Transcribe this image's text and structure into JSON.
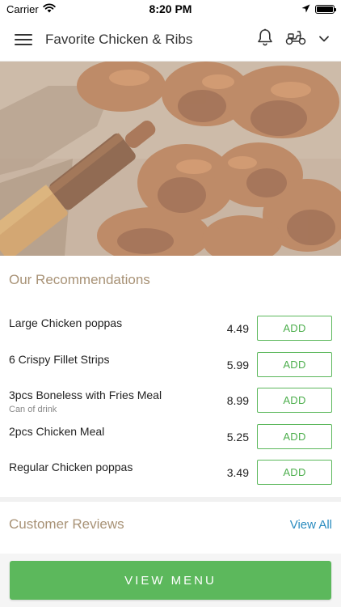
{
  "status_bar": {
    "carrier": "Carrier",
    "time": "8:20 PM"
  },
  "header": {
    "title": "Favorite Chicken & Ribs"
  },
  "icons": {
    "menu": "hamburger-menu-icon",
    "bell": "bell-icon",
    "delivery": "scooter-icon",
    "dropdown": "chevron-down-icon"
  },
  "recommendations": {
    "title": "Our Recommendations",
    "items": [
      {
        "name": "Large Chicken poppas",
        "subtitle": "",
        "price": "4.49",
        "button": "ADD"
      },
      {
        "name": "6 Crispy Fillet Strips",
        "subtitle": "",
        "price": "5.99",
        "button": "ADD"
      },
      {
        "name": "3pcs Boneless with Fries Meal",
        "subtitle": "Can of drink",
        "price": "8.99",
        "button": "ADD"
      },
      {
        "name": "2pcs Chicken Meal",
        "subtitle": "",
        "price": "5.25",
        "button": "ADD"
      },
      {
        "name": "Regular Chicken poppas",
        "subtitle": "",
        "price": "3.49",
        "button": "ADD"
      }
    ]
  },
  "reviews": {
    "title": "Customer Reviews",
    "view_all": "View All"
  },
  "footer": {
    "view_menu": "VIEW MENU"
  },
  "colors": {
    "accent_green": "#5cb85c",
    "section_title": "#a89276",
    "link_blue": "#2a8bbf"
  }
}
